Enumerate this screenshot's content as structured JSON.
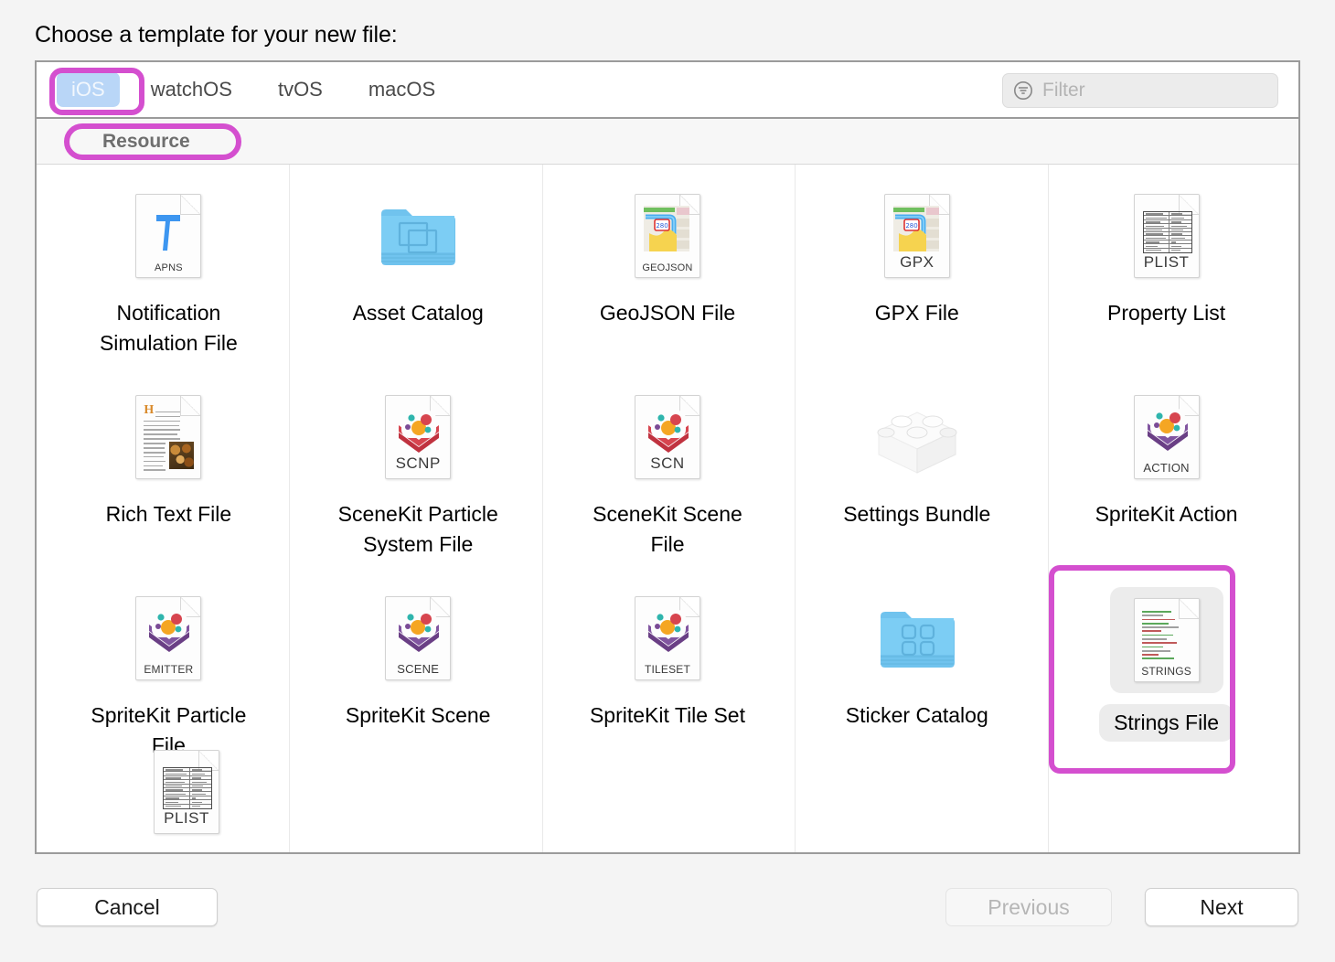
{
  "dialog": {
    "prompt": "Choose a template for your new file:"
  },
  "tabs": [
    {
      "label": "iOS",
      "active": true
    },
    {
      "label": "watchOS",
      "active": false
    },
    {
      "label": "tvOS",
      "active": false
    },
    {
      "label": "macOS",
      "active": false
    }
  ],
  "filter": {
    "placeholder": "Filter",
    "value": "",
    "icon": "filter-icon"
  },
  "section": {
    "title": "Resource"
  },
  "templates": [
    {
      "label": "Notification Simulation File",
      "badge": "APNS",
      "icon": "apns-file-icon",
      "selected": false
    },
    {
      "label": "Asset Catalog",
      "badge": "",
      "icon": "asset-catalog-folder-icon",
      "selected": false
    },
    {
      "label": "GeoJSON File",
      "badge": "GEOJSON",
      "icon": "geojson-file-icon",
      "selected": false
    },
    {
      "label": "GPX File",
      "badge": "GPX",
      "icon": "gpx-file-icon",
      "selected": false
    },
    {
      "label": "Property List",
      "badge": "PLIST",
      "icon": "plist-file-icon",
      "selected": false
    },
    {
      "label": "Rich Text File",
      "badge": "",
      "icon": "rich-text-file-icon",
      "selected": false
    },
    {
      "label": "SceneKit Particle System File",
      "badge": "SCNP",
      "icon": "scenekit-particle-file-icon",
      "selected": false
    },
    {
      "label": "SceneKit Scene File",
      "badge": "SCN",
      "icon": "scenekit-scene-file-icon",
      "selected": false
    },
    {
      "label": "Settings Bundle",
      "badge": "",
      "icon": "settings-bundle-icon",
      "selected": false
    },
    {
      "label": "SpriteKit Action",
      "badge": "ACTION",
      "icon": "spritekit-action-file-icon",
      "selected": false
    },
    {
      "label": "SpriteKit Particle File",
      "badge": "EMITTER",
      "icon": "spritekit-particle-file-icon",
      "selected": false
    },
    {
      "label": "SpriteKit Scene",
      "badge": "SCENE",
      "icon": "spritekit-scene-file-icon",
      "selected": false
    },
    {
      "label": "SpriteKit Tile Set",
      "badge": "TILESET",
      "icon": "spritekit-tileset-file-icon",
      "selected": false
    },
    {
      "label": "Sticker Catalog",
      "badge": "",
      "icon": "sticker-catalog-folder-icon",
      "selected": false
    },
    {
      "label": "Strings File",
      "badge": "STRINGS",
      "icon": "strings-file-icon",
      "selected": true
    }
  ],
  "partial_row": [
    {
      "label": "",
      "badge": "",
      "icon": "plist-file-icon-partial"
    }
  ],
  "footer": {
    "cancel_label": "Cancel",
    "previous_label": "Previous",
    "previous_disabled": true,
    "next_label": "Next"
  },
  "highlights": {
    "color": "#d44fcf",
    "targets": [
      "tab-ios",
      "section-resource",
      "template-strings-file"
    ]
  },
  "colors": {
    "selected_tab_bg": "#b9d6f7",
    "panel_border": "#9b9b9b",
    "window_bg": "#f4f4f4",
    "folder_blue": "#74c6f0",
    "scenekit_red": "#d7454f",
    "spritekit_purple": "#7b4b96"
  }
}
